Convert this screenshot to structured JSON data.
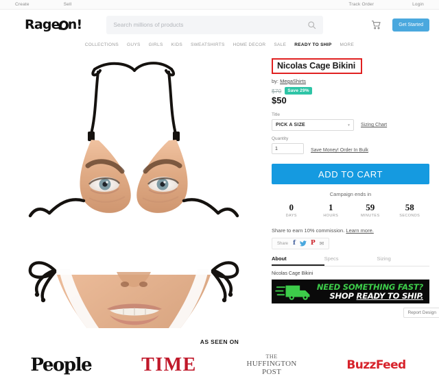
{
  "utility_bar": {
    "left_links": [
      "Create",
      "Sell"
    ],
    "right_links": [
      "Track Order",
      "Login"
    ]
  },
  "header": {
    "logo_pre": "Rage",
    "logo_post": "n!",
    "logo_icon": "rageon-blob-icon",
    "search": {
      "placeholder": "Search millions of products",
      "value": "",
      "icon": "search-icon"
    },
    "cart_icon": "shopping-cart-icon",
    "get_started_label": "Get Started"
  },
  "main_nav": {
    "items": [
      {
        "label": "COLLECTIONS",
        "active": false
      },
      {
        "label": "GUYS",
        "active": false
      },
      {
        "label": "GIRLS",
        "active": false
      },
      {
        "label": "KIDS",
        "active": false
      },
      {
        "label": "SWEATSHIRTS",
        "active": false
      },
      {
        "label": "HOME DECOR",
        "active": false
      },
      {
        "label": "SALE",
        "active": false
      },
      {
        "label": "READY TO SHIP",
        "active": true
      },
      {
        "label": "MORE",
        "active": false
      }
    ]
  },
  "product": {
    "title": "Nicolas Cage Bikini",
    "title_highlight_color": "#e02020",
    "by_prefix": "by:",
    "seller": "MegaShirts",
    "old_price": "$70",
    "save_badge": "Save 29%",
    "save_badge_color": "#2ec4a6",
    "new_price": "$50",
    "size_label": "Title",
    "size_value": "PICK A SIZE",
    "sizing_chart_link": "Sizing Chart",
    "quantity_label": "Quantity",
    "quantity_value": "1",
    "bulk_link": "Save Money! Order In Bulk",
    "add_to_cart_label": "ADD TO CART",
    "add_to_cart_color": "#159ae0",
    "image_alt": "bikini-with-face-print"
  },
  "countdown": {
    "heading": "Campaign ends in",
    "cells": [
      {
        "value": "0",
        "label": "DAYS"
      },
      {
        "value": "1",
        "label": "HOURS"
      },
      {
        "value": "59",
        "label": "MINUTES"
      },
      {
        "value": "58",
        "label": "SECONDS"
      }
    ]
  },
  "share": {
    "note": "Share to earn 10% commission.",
    "learn_more": "Learn more.",
    "bar_label": "Share",
    "icons": [
      {
        "name": "facebook-icon",
        "glyph": "f",
        "color": "#3b5998"
      },
      {
        "name": "twitter-icon",
        "glyph": "ᴠ",
        "color": "#4aa8de"
      },
      {
        "name": "pinterest-icon",
        "glyph": "P",
        "color": "#cb2027"
      },
      {
        "name": "email-icon",
        "glyph": "✉",
        "color": "#8a8a8a"
      }
    ]
  },
  "tabs": [
    {
      "label": "About",
      "active": true
    },
    {
      "label": "Specs",
      "active": false
    },
    {
      "label": "Sizing",
      "active": false
    }
  ],
  "description": "Nicolas Cage Bikini",
  "banner": {
    "line1": "NEED SOMETHING FAST?",
    "line2_pre": "SHOP ",
    "line2_underlined": "READY TO SHIP.",
    "icon": "delivery-truck-icon",
    "accent_color": "#3dcc4a",
    "background": "#0a0a0a"
  },
  "report_button": "Report Design",
  "as_seen_on": {
    "title": "AS SEEN ON",
    "brands": [
      {
        "name": "people-logo",
        "text": "People"
      },
      {
        "name": "time-logo",
        "text": "TIME"
      },
      {
        "name": "huffington-post-logo",
        "line1": "THE",
        "line2": "HUFFINGTON",
        "line3": "POST"
      },
      {
        "name": "buzzfeed-logo",
        "text": "BuzzFeed"
      }
    ]
  }
}
